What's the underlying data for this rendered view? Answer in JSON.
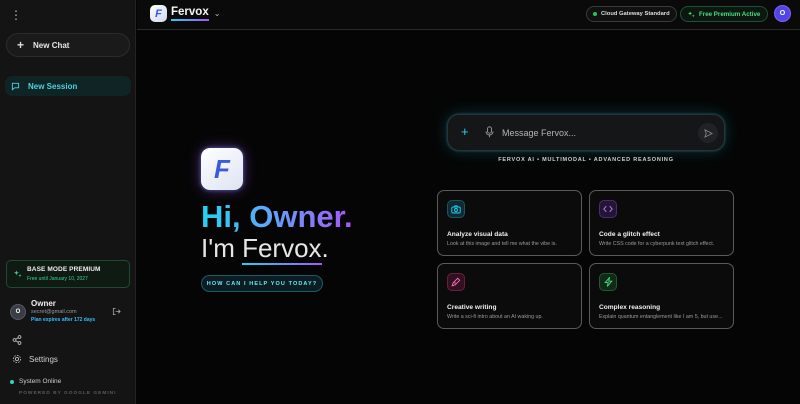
{
  "sidebar": {
    "new_chat": "New Chat",
    "session": "New Session",
    "premium": {
      "title": "BASE MODE PREMIUM",
      "subtitle": "Free until January 10, 2027"
    },
    "user": {
      "initial": "O",
      "name": "Owner",
      "email": "secret@gmail.com",
      "plan": "Plan expires after 172 days"
    },
    "settings": "Settings",
    "status": "System Online",
    "powered": "POWERED BY GOOGLE GEMINI"
  },
  "header": {
    "brand": "Fervox",
    "brand_logo_letter": "F",
    "gateway": "Cloud Gateway Standard",
    "premium": "Free Premium Active",
    "avatar": "O"
  },
  "hero": {
    "greeting": "Hi, Owner.",
    "intro_prefix": "I'm ",
    "intro_name": "Fervox",
    "intro_suffix": ".",
    "help": "HOW CAN I HELP YOU TODAY?"
  },
  "composer": {
    "placeholder": "Message Fervox...",
    "tagline": "FERVOX AI • MULTIMODAL • ADVANCED REASONING"
  },
  "cards": [
    {
      "title": "Analyze visual data",
      "desc": "Look at this image and tell me what the vibe is.",
      "icon": "camera-icon"
    },
    {
      "title": "Code a glitch effect",
      "desc": "Write CSS code for a cyberpunk text glitch effect.",
      "icon": "code-icon"
    },
    {
      "title": "Creative writing",
      "desc": "Write a sci-fi intro about an AI waking up.",
      "icon": "pen-icon"
    },
    {
      "title": "Complex reasoning",
      "desc": "Explain quantum entanglement like I am 5, but use...",
      "icon": "bolt-icon"
    }
  ],
  "colors": {
    "accent": "#22d3ee",
    "purple": "#a855f7",
    "green": "#4ade80",
    "bg": "#050505"
  }
}
